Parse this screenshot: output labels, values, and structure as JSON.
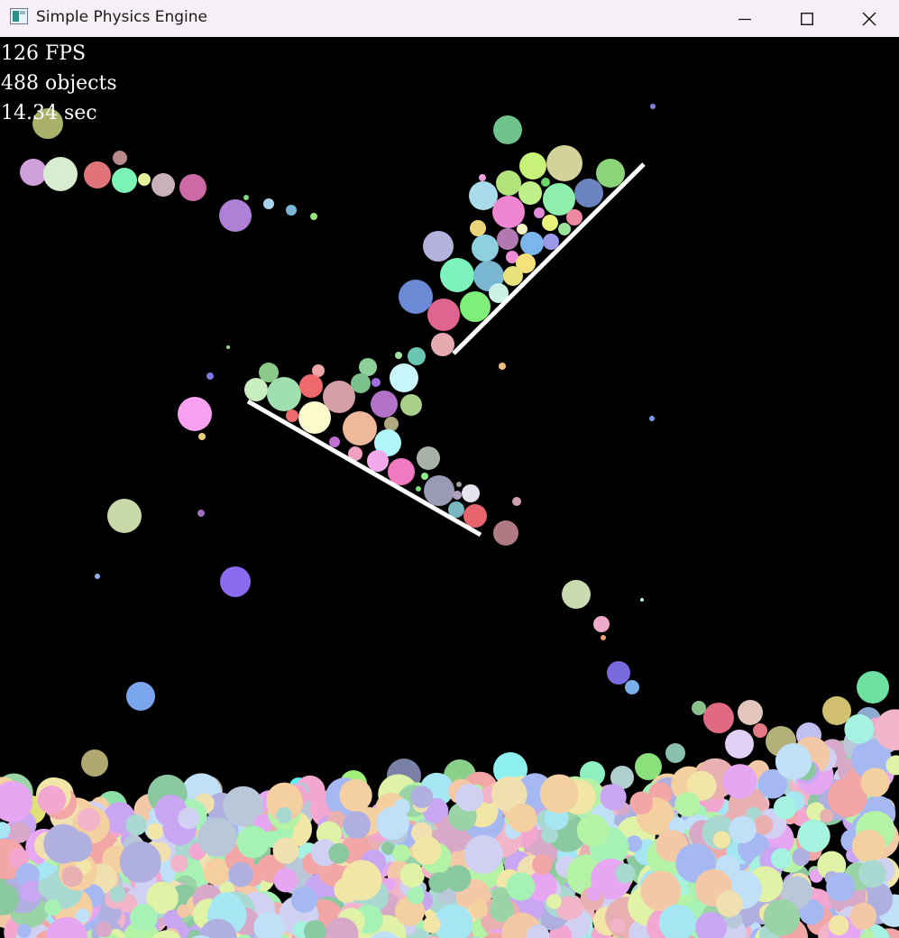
{
  "window": {
    "title": "Simple Physics Engine",
    "controls": {
      "minimize": "minimize",
      "maximize": "maximize",
      "close": "close"
    }
  },
  "hud": {
    "fps": "126 FPS",
    "objects": "488 objects",
    "time": "14.34 sec"
  },
  "scene": {
    "background": "#000000",
    "line_color": "#ffffff"
  }
}
